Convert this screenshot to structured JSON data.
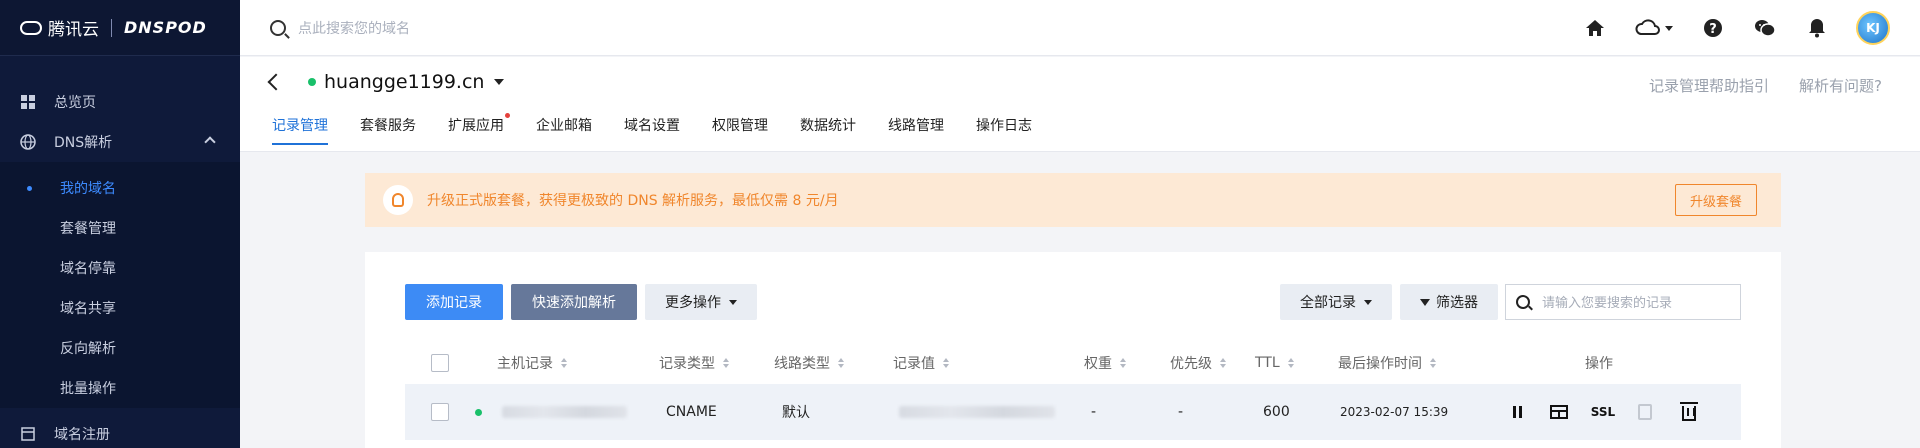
{
  "brand": {
    "tencent": "腾讯云",
    "dnspod": "DNSPOD"
  },
  "sidebar": {
    "items": [
      {
        "label": "总览页",
        "icon": "grid-icon"
      },
      {
        "label": "DNS解析",
        "icon": "globe-icon"
      }
    ],
    "sub_items": [
      {
        "label": "我的域名",
        "active": true
      },
      {
        "label": "套餐管理"
      },
      {
        "label": "域名停靠"
      },
      {
        "label": "域名共享"
      },
      {
        "label": "反向解析"
      },
      {
        "label": "批量操作"
      }
    ],
    "bottom_item": {
      "label": "域名注册",
      "icon": "browser-icon"
    }
  },
  "topbar": {
    "search_placeholder": "点此搜索您的域名",
    "avatar_text": "KJ"
  },
  "domain": {
    "name": "huangge1199.cn",
    "status_color": "#19c06a",
    "help_links": [
      "记录管理帮助指引",
      "解析有问题?"
    ]
  },
  "tabs": [
    {
      "label": "记录管理",
      "active": true
    },
    {
      "label": "套餐服务"
    },
    {
      "label": "扩展应用",
      "dot": true
    },
    {
      "label": "企业邮箱"
    },
    {
      "label": "域名设置"
    },
    {
      "label": "权限管理"
    },
    {
      "label": "数据统计"
    },
    {
      "label": "线路管理"
    },
    {
      "label": "操作日志"
    }
  ],
  "banner": {
    "text": "升级正式版套餐，获得更极致的 DNS 解析服务，最低仅需 8 元/月",
    "button": "升级套餐"
  },
  "toolbar": {
    "add_record": "添加记录",
    "quick_add": "快速添加解析",
    "more_ops": "更多操作",
    "all_records": "全部记录",
    "filter": "筛选器",
    "search_placeholder": "请输入您要搜索的记录"
  },
  "table": {
    "headers": {
      "host": "主机记录",
      "type": "记录类型",
      "line": "线路类型",
      "value": "记录值",
      "weight": "权重",
      "priority": "优先级",
      "ttl": "TTL",
      "updated": "最后操作时间",
      "actions": "操作"
    },
    "rows": [
      {
        "type": "CNAME",
        "line": "默认",
        "weight": "-",
        "priority": "-",
        "ttl": "600",
        "updated": "2023-02-07 15:39",
        "ssl": "SSL"
      }
    ]
  }
}
